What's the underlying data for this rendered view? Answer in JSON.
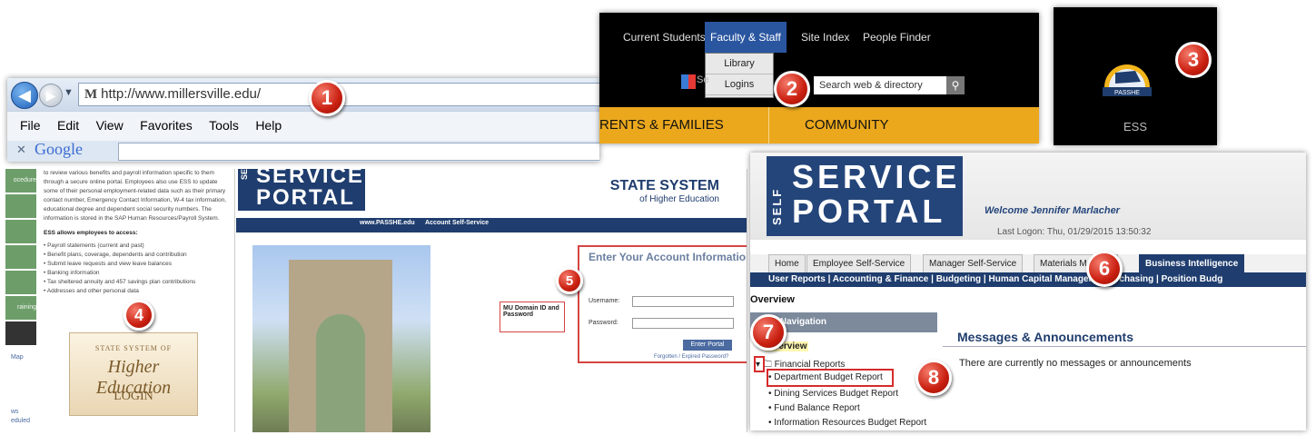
{
  "browser": {
    "url_label": "http://www.millersville.edu/",
    "menu": [
      "File",
      "Edit",
      "View",
      "Favorites",
      "Tools",
      "Help"
    ],
    "search_text": "Google"
  },
  "header": {
    "tabs": [
      "Current Students",
      "Faculty & Staff",
      "Site Index",
      "People Finder"
    ],
    "dropdown": [
      "Library",
      "Logins"
    ],
    "search_placeholder": "Search web & directory",
    "search_prefix": "Se",
    "bands": [
      "RENTS & FAMILIES",
      "COMMUNITY"
    ]
  },
  "ess_tile": {
    "label": "ESS",
    "logo_text": "PASSHE"
  },
  "ess_page": {
    "side_items": [
      "ocedure",
      "",
      "",
      "",
      "",
      "raining",
      "",
      "Map",
      "",
      "ws",
      "eduled"
    ],
    "intro": "to review various benefits and payroll information specific to them through a secure online portal. Employees also use ESS to update some of their personal employment-related data such as their primary contact number, Emergency Contact Information, W-4 tax information, educational degree and dependent social security numbers. The information is stored in the SAP Human Resources/Payroll System.",
    "list_title": "ESS allows employees to access:",
    "list": [
      "Payroll statements (current and past)",
      "Benefit plans, coverage, dependents and contribution",
      "Submit leave requests and view leave balances",
      "Banking information",
      "Tax sheltered annuity and 457 savings plan contributions",
      "Addresses and other personal data"
    ],
    "login_line1": "STATE SYSTEM OF",
    "login_line2": "Higher Education",
    "login_line3": "LOGIN"
  },
  "portal_login": {
    "logo_word1": "SERVICE",
    "logo_word2": "PORTAL",
    "logo_side": "SELF",
    "brand_a": "STATE SYSTEM",
    "brand_b": "of Higher Education",
    "nav": [
      "www.PASSHE.edu",
      "Account Self-Service"
    ],
    "form_title": "Enter Your Account Information",
    "username_label": "Username:",
    "password_label": "Password:",
    "enter_button": "Enter Portal",
    "forgot": "Forgotten / Expired Password?",
    "callout": "MU Domain ID and Password"
  },
  "portal": {
    "logo_side": "SELF",
    "logo_word1": "SERVICE",
    "logo_word2": "PORTAL",
    "welcome": "Welcome Jennifer Marlacher",
    "last_logon": "Last Logon: Thu, 01/29/2015 13:50:32",
    "tabs": [
      "Home",
      "Employee Self-Service",
      "Manager Self-Service",
      "Materials Manage",
      "Business Intelligence"
    ],
    "subnav": "User Reports  |  Accounting & Finance  |  Budgeting  |  Human Capital Managem  |  Purchasing  |  Position Budg",
    "overview": "Overview",
    "detailed_nav": "d Navigation",
    "tree_overview": "Overview",
    "tree": [
      "Financial Reports",
      "Department Budget Report",
      "Dining Services Budget Report",
      "Fund Balance Report",
      "Information Resources Budget Report"
    ],
    "msg_title": "Messages & Announcements",
    "msg_text": "There are currently no messages or announcements"
  },
  "steps": [
    "1",
    "2",
    "3",
    "4",
    "5",
    "6",
    "7",
    "8"
  ]
}
